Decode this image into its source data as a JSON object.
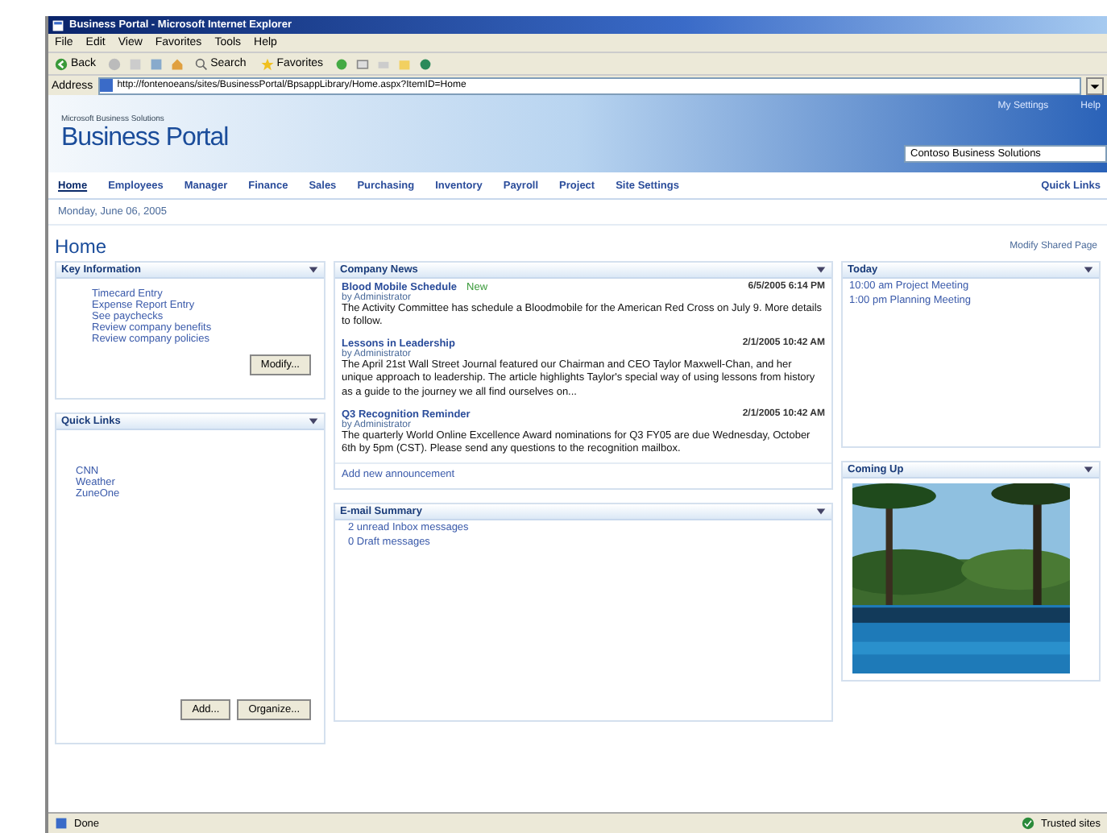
{
  "window": {
    "title": "Business Portal - Microsoft Internet Explorer"
  },
  "menu": [
    "File",
    "Edit",
    "View",
    "Favorites",
    "Tools",
    "Help"
  ],
  "toolbar": {
    "back": "Back",
    "search": "Search",
    "favorites": "Favorites"
  },
  "address": {
    "label": "Address",
    "value": "http://fontenoeans/sites/BusinessPortal/BpsappLibrary/Home.aspx?ItemID=Home"
  },
  "banner": {
    "suite": "Microsoft Business Solutions",
    "title": "Business Portal",
    "links": [
      "My Settings",
      "Help"
    ],
    "company": "Contoso Business Solutions"
  },
  "nav": [
    {
      "label": "Home",
      "selected": true
    },
    {
      "label": "Employees",
      "selected": false
    },
    {
      "label": "Manager",
      "selected": false
    },
    {
      "label": "Finance",
      "selected": false
    },
    {
      "label": "Sales",
      "selected": false
    },
    {
      "label": "Purchasing",
      "selected": false
    },
    {
      "label": "Inventory",
      "selected": false
    },
    {
      "label": "Payroll",
      "selected": false
    },
    {
      "label": "Project",
      "selected": false
    },
    {
      "label": "Site Settings",
      "selected": false
    }
  ],
  "quick_links_menu": "Quick Links",
  "date": "Monday, June 06, 2005",
  "page_title": "Home",
  "modify_page": "Modify Shared Page",
  "key_information": {
    "title": "Key Information",
    "items": [
      "Timecard Entry",
      "Expense Report Entry",
      "See paychecks",
      "Review company benefits",
      "Review company policies"
    ],
    "buttons": [
      "Modify..."
    ]
  },
  "quick_links": {
    "title": "Quick Links",
    "items": [
      "CNN",
      "Weather",
      "ZuneOne"
    ],
    "buttons": [
      "Add...",
      "Organize..."
    ]
  },
  "company_news": {
    "title": "Company News",
    "items": [
      {
        "headline": "Blood Mobile Schedule",
        "badge": "New",
        "date": "6/5/2005 6:14 PM",
        "by": "by Administrator",
        "body": "The Activity Committee has schedule a Bloodmobile for the American Red Cross on July 9. More details to follow."
      },
      {
        "headline": "Lessons in Leadership",
        "date": "2/1/2005 10:42 AM",
        "by": "by Administrator",
        "body": "The April 21st Wall Street Journal featured our Chairman and CEO Taylor Maxwell-Chan, and her unique approach to leadership. The article highlights Taylor's special way of using lessons from history as a guide to the journey we all find ourselves on..."
      },
      {
        "headline": "Q3 Recognition Reminder",
        "date": "2/1/2005 10:42 AM",
        "by": "by Administrator",
        "body": "The quarterly World Online Excellence Award nominations for Q3 FY05 are due Wednesday, October 6th by 5pm (CST). Please send any questions to the recognition mailbox."
      }
    ],
    "add_link": "Add new announcement"
  },
  "email_summary": {
    "title": "E-mail Summary",
    "items": [
      "2 unread Inbox messages",
      "0 Draft messages"
    ]
  },
  "today": {
    "title": "Today",
    "items": [
      "10:00 am  Project Meeting",
      "1:00 pm   Planning Meeting"
    ]
  },
  "coming_up": {
    "title": "Coming Up"
  },
  "status_bar": {
    "text": "Done",
    "zone": "Trusted sites"
  }
}
